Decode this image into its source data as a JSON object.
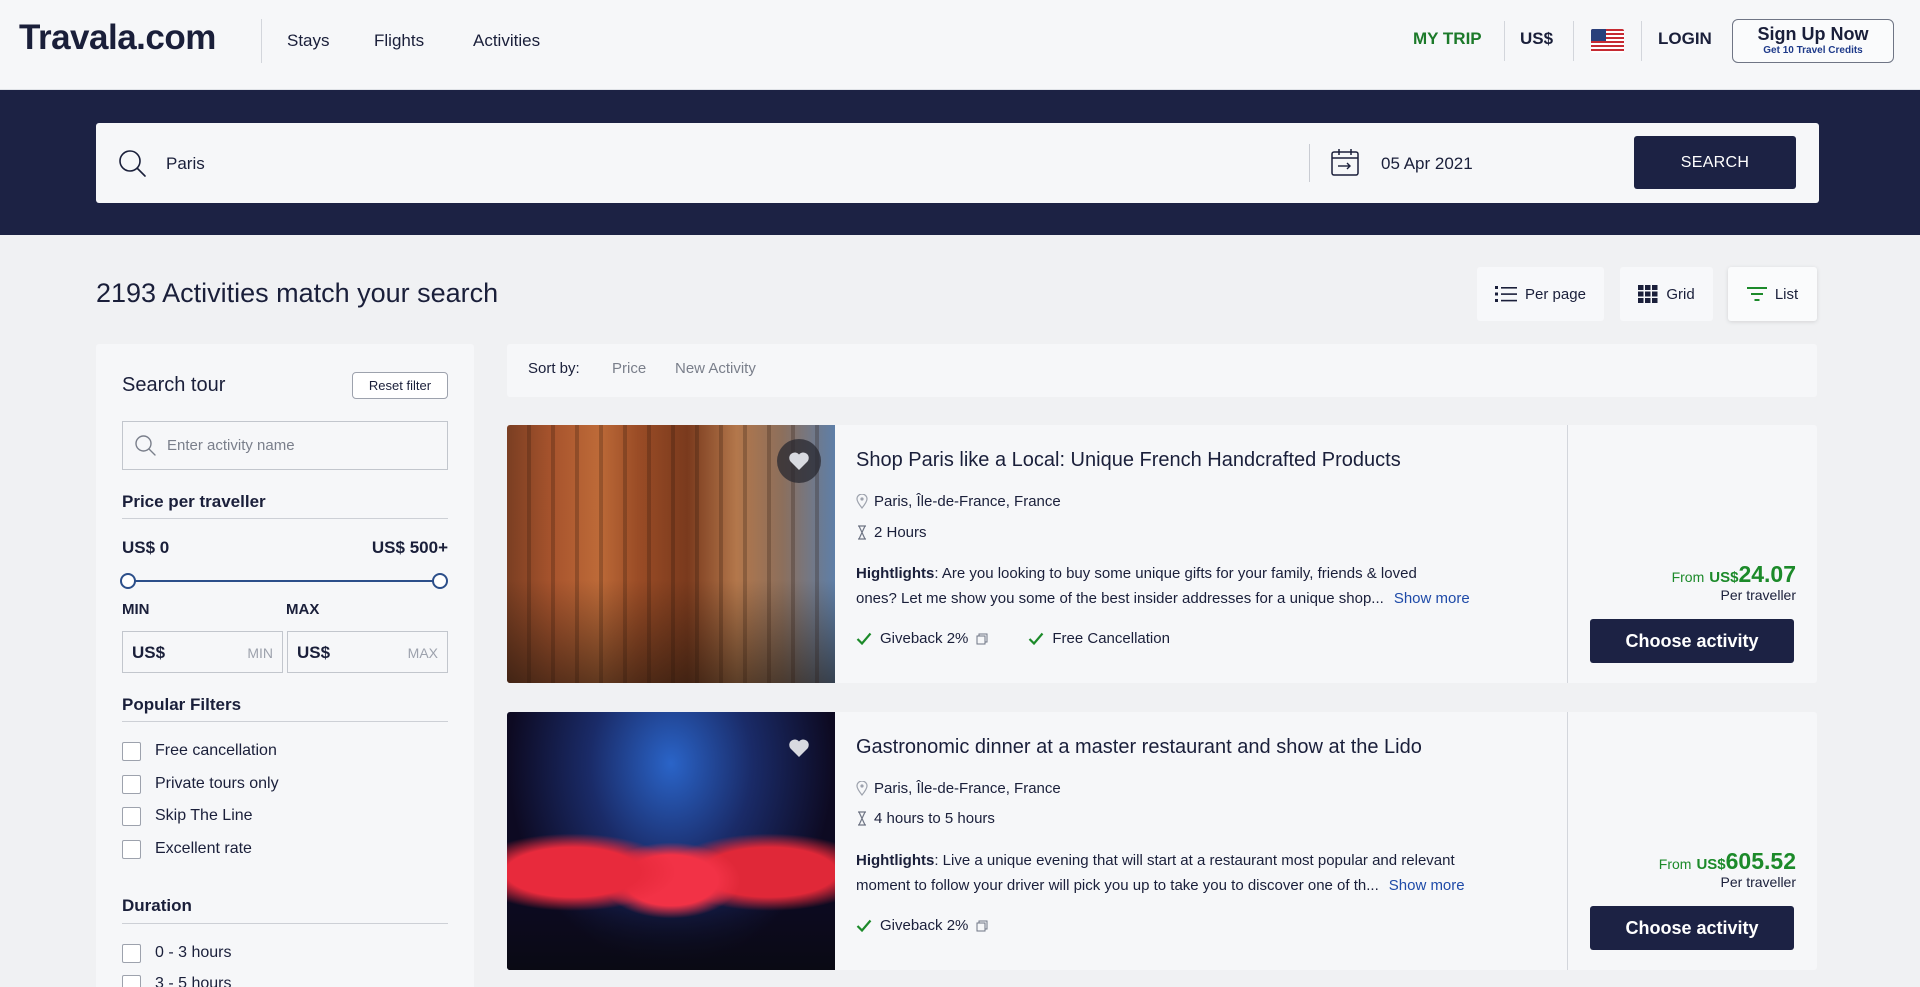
{
  "header": {
    "logo": "Travala.com",
    "nav": [
      "Stays",
      "Flights",
      "Activities"
    ],
    "my_trip": "MY TRIP",
    "currency": "US$",
    "login": "LOGIN",
    "signup": "Sign Up Now",
    "signup_sub": "Get 10 Travel Credits"
  },
  "search": {
    "destination": "Paris",
    "date": "05 Apr 2021",
    "button": "SEARCH"
  },
  "results": {
    "title": "2193 Activities match your search",
    "views": [
      "Per page",
      "Grid",
      "List"
    ],
    "active_view": "List"
  },
  "sidebar": {
    "title": "Search tour",
    "reset": "Reset filter",
    "activity_placeholder": "Enter activity name",
    "price_heading": "Price per traveller",
    "price_min": "US$ 0",
    "price_max": "US$ 500+",
    "price_range_fraction": [
      0,
      1
    ],
    "min_label": "MIN",
    "max_label": "MAX",
    "input_currency": "US$",
    "min_hint": "MIN",
    "max_hint": "MAX",
    "popular_heading": "Popular Filters",
    "popular_filters": [
      "Free cancellation",
      "Private tours only",
      "Skip The Line",
      "Excellent rate"
    ],
    "duration_heading": "Duration",
    "duration_filters": [
      "0 - 3 hours",
      "3 - 5 hours"
    ]
  },
  "sort": {
    "label": "Sort by:",
    "options": [
      "Price",
      "New Activity"
    ]
  },
  "activities": [
    {
      "title": "Shop Paris like a Local: Unique French Handcrafted Products",
      "location": "Paris, Île-de-France, France",
      "duration": "2 Hours",
      "highlight_label": "Hightlights",
      "highlight_line1": ": Are you looking to buy some unique gifts for your family, friends & loved",
      "highlight_line2": "ones?  Let me show you some of the best insider addresses for a unique shop...",
      "show_more": "Show more",
      "giveback": "Giveback 2%",
      "free_cancel": "Free Cancellation",
      "from": "From",
      "price_currency": "US$",
      "price": "24.07",
      "per": "Per traveller",
      "cta": "Choose activity"
    },
    {
      "title": "Gastronomic dinner at a master restaurant and show at the Lido",
      "location": "Paris, Île-de-France, France",
      "duration": "4 hours to 5 hours",
      "highlight_label": "Hightlights",
      "highlight_line1": ": Live a unique evening that will start at a restaurant most popular and relevant",
      "highlight_line2": "moment to follow your driver will pick you up to take you to discover one of th...",
      "show_more": "Show more",
      "giveback": "Giveback 2%",
      "from": "From",
      "price_currency": "US$",
      "price": "605.52",
      "per": "Per traveller",
      "cta": "Choose activity"
    }
  ],
  "colors": {
    "navy": "#1c2244",
    "green": "#1c8a2a",
    "link": "#1e4aa8"
  }
}
